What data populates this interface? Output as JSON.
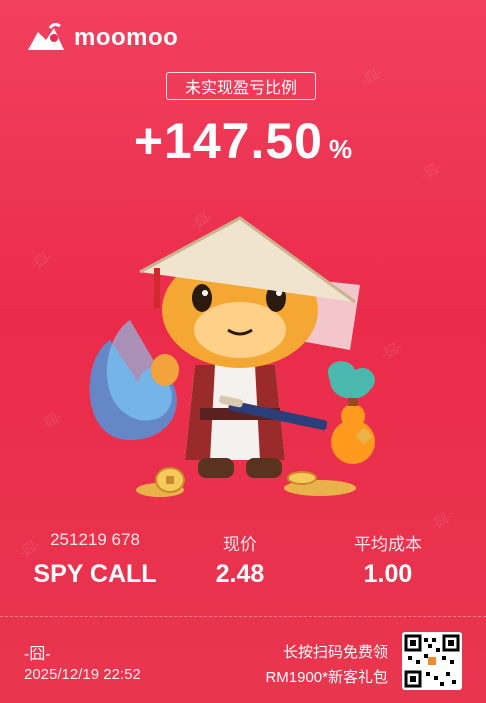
{
  "brand": {
    "name": "moomoo"
  },
  "header": {
    "badge": "未实现盈亏比例"
  },
  "performance": {
    "value": "+147.50",
    "unit": "%"
  },
  "stats": [
    {
      "label": "251219 678",
      "value": "SPY CALL"
    },
    {
      "label": "现价",
      "value": "2.48"
    },
    {
      "label": "平均成本",
      "value": "1.00"
    }
  ],
  "footer": {
    "user": "-囧-",
    "datetime": "2025/12/19 22:52",
    "promo_line1": "长按扫码免费领",
    "promo_line2": "RM1900*新客礼包"
  },
  "watermark": "-囧-",
  "icons": [
    "moomoo-logo-icon",
    "qr-code"
  ],
  "colors": {
    "background": "#ea2c4a",
    "text": "#ffffff"
  }
}
